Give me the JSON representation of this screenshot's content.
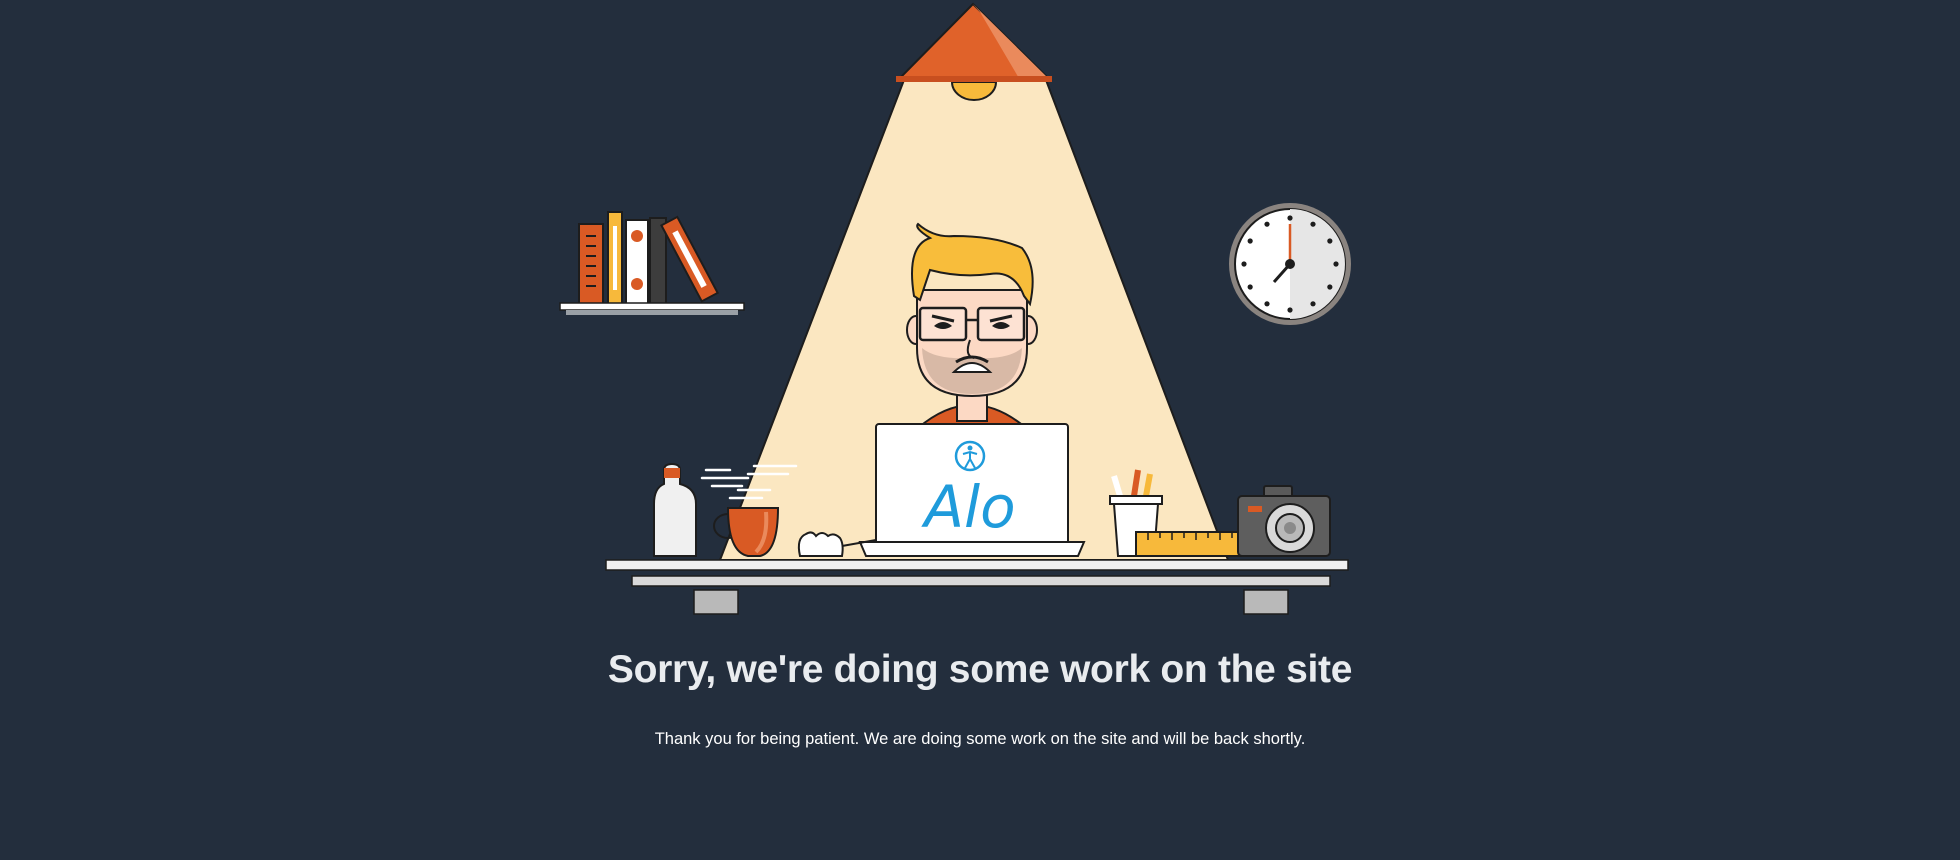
{
  "maintenance": {
    "headline": "Sorry, we're doing some work on the site",
    "message": "Thank you for being patient. We are doing some work on the site and will be back shortly."
  },
  "laptop": {
    "brand_text": "Alo",
    "brand_color": "#1f9bdb"
  },
  "colors": {
    "background": "#232e3d",
    "lamp": "#e0622a",
    "light_beam": "#fbe7c1",
    "hair": "#f8bd3b",
    "accent_orange": "#d95a24"
  },
  "icons": [
    "ceiling-lamp-icon",
    "bookshelf-icon",
    "wall-clock-icon",
    "developer-character-icon",
    "laptop-icon",
    "water-bottle-icon",
    "coffee-cup-icon",
    "pencil-cup-icon",
    "ruler-icon",
    "camera-icon",
    "desk-icon"
  ]
}
